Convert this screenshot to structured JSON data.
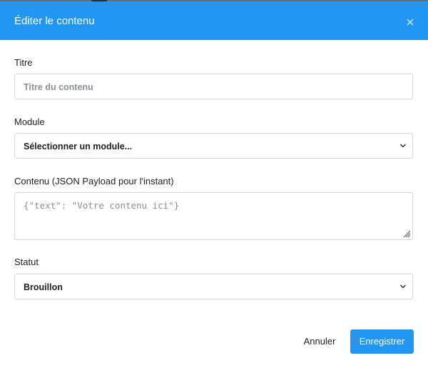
{
  "dialog": {
    "title": "Éditer le contenu",
    "close_icon": "close-icon"
  },
  "form": {
    "title_field": {
      "label": "Titre",
      "placeholder": "Titre du contenu",
      "value": ""
    },
    "module_field": {
      "label": "Module",
      "selected": "Sélectionner un module..."
    },
    "content_field": {
      "label": "Contenu (JSON Payload pour l'instant)",
      "placeholder": "{\"text\": \"Votre contenu ici\"}",
      "value": ""
    },
    "status_field": {
      "label": "Statut",
      "selected": "Brouillon"
    }
  },
  "actions": {
    "cancel_label": "Annuler",
    "save_label": "Enregistrer"
  },
  "colors": {
    "header_bg": "#2196f3",
    "primary_button": "#2196f3",
    "border": "#d4d7db"
  }
}
